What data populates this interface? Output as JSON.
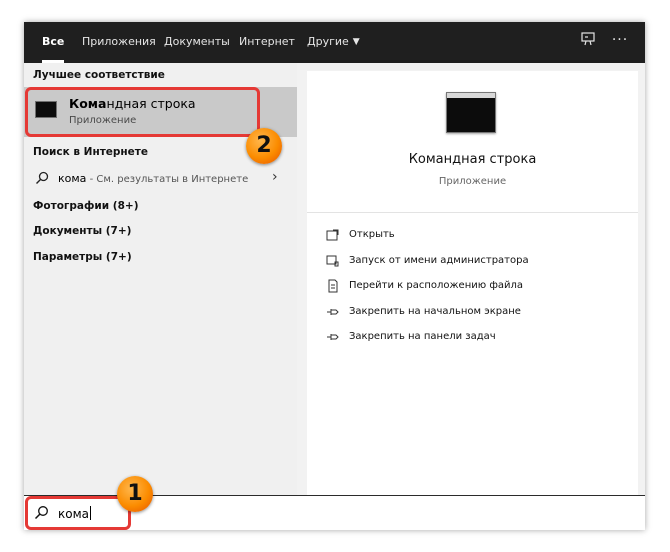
{
  "tabs": [
    {
      "label": "Все",
      "active": true
    },
    {
      "label": "Приложения"
    },
    {
      "label": "Документы"
    },
    {
      "label": "Интернет"
    },
    {
      "label": "Другие"
    }
  ],
  "toolbar": {
    "feedback_icon": "feedback-icon",
    "more_label": "···"
  },
  "left": {
    "best_match_header": "Лучшее соответствие",
    "best_match": {
      "title_bold": "Кома",
      "title_rest": "ндная строка",
      "subtitle": "Приложение",
      "icon": "command-prompt-icon"
    },
    "web_header": "Поиск в Интернете",
    "web_result": {
      "query": "кома",
      "hint": " - См. результаты в Интернете"
    },
    "categories": [
      "Фотографии (8+)",
      "Документы (7+)",
      "Параметры (7+)"
    ]
  },
  "right": {
    "title": "Командная строка",
    "subtitle": "Приложение",
    "actions": [
      {
        "label": "Открыть",
        "icon": "open-icon"
      },
      {
        "label": "Запуск от имени администратора",
        "icon": "run-as-admin-icon"
      },
      {
        "label": "Перейти к расположению файла",
        "icon": "file-location-icon"
      },
      {
        "label": "Закрепить на начальном экране",
        "icon": "pin-icon"
      },
      {
        "label": "Закрепить на панели задач",
        "icon": "pin-icon"
      }
    ]
  },
  "search": {
    "value": "кома"
  },
  "annotations": [
    {
      "label": "1"
    },
    {
      "label": "2"
    }
  ],
  "colors": {
    "tabbar": "#1f1f1f",
    "selected": "#c9c9c9",
    "highlight": "#e53935",
    "badge": "#fb8c00"
  }
}
